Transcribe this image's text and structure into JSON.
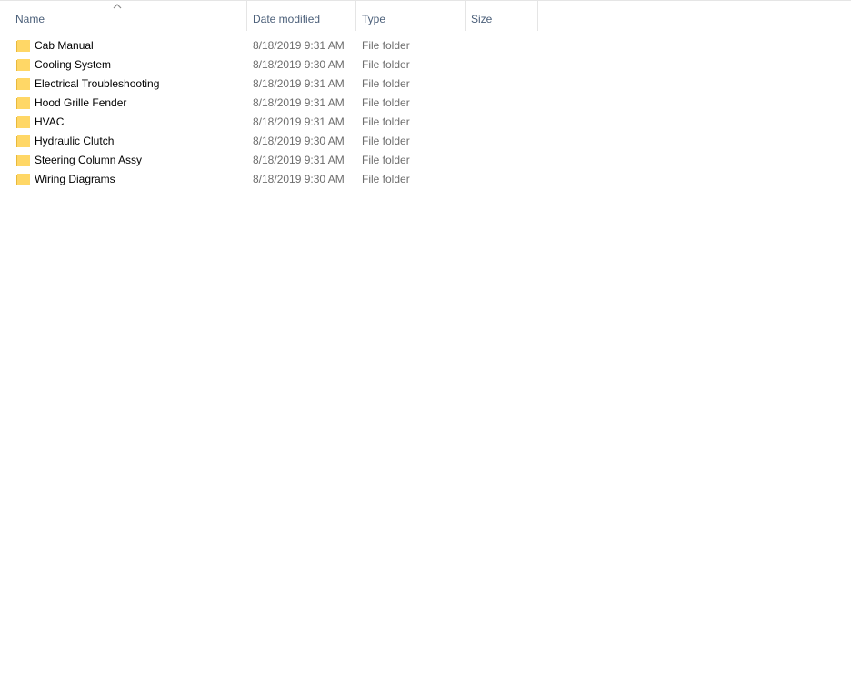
{
  "columns": {
    "name": "Name",
    "date_modified": "Date modified",
    "type": "Type",
    "size": "Size"
  },
  "sort": {
    "column": "name",
    "direction": "ascending",
    "icon": "chevron-up-icon"
  },
  "colors": {
    "header_text": "#4c607a",
    "folder_fill": "#ffd766",
    "folder_back": "#e8b93c",
    "secondary_text": "#6d6d6d"
  },
  "files": [
    {
      "name": "Cab Manual",
      "date": "8/18/2019 9:31 AM",
      "type": "File folder",
      "size": "",
      "icon": "folder-icon"
    },
    {
      "name": "Cooling System",
      "date": "8/18/2019 9:30 AM",
      "type": "File folder",
      "size": "",
      "icon": "folder-icon"
    },
    {
      "name": "Electrical Troubleshooting",
      "date": "8/18/2019 9:31 AM",
      "type": "File folder",
      "size": "",
      "icon": "folder-icon"
    },
    {
      "name": "Hood Grille Fender",
      "date": "8/18/2019 9:31 AM",
      "type": "File folder",
      "size": "",
      "icon": "folder-icon"
    },
    {
      "name": "HVAC",
      "date": "8/18/2019 9:31 AM",
      "type": "File folder",
      "size": "",
      "icon": "folder-icon"
    },
    {
      "name": "Hydraulic Clutch",
      "date": "8/18/2019 9:30 AM",
      "type": "File folder",
      "size": "",
      "icon": "folder-icon"
    },
    {
      "name": "Steering Column Assy",
      "date": "8/18/2019 9:31 AM",
      "type": "File folder",
      "size": "",
      "icon": "folder-icon"
    },
    {
      "name": "Wiring Diagrams",
      "date": "8/18/2019 9:30 AM",
      "type": "File folder",
      "size": "",
      "icon": "folder-icon"
    }
  ]
}
